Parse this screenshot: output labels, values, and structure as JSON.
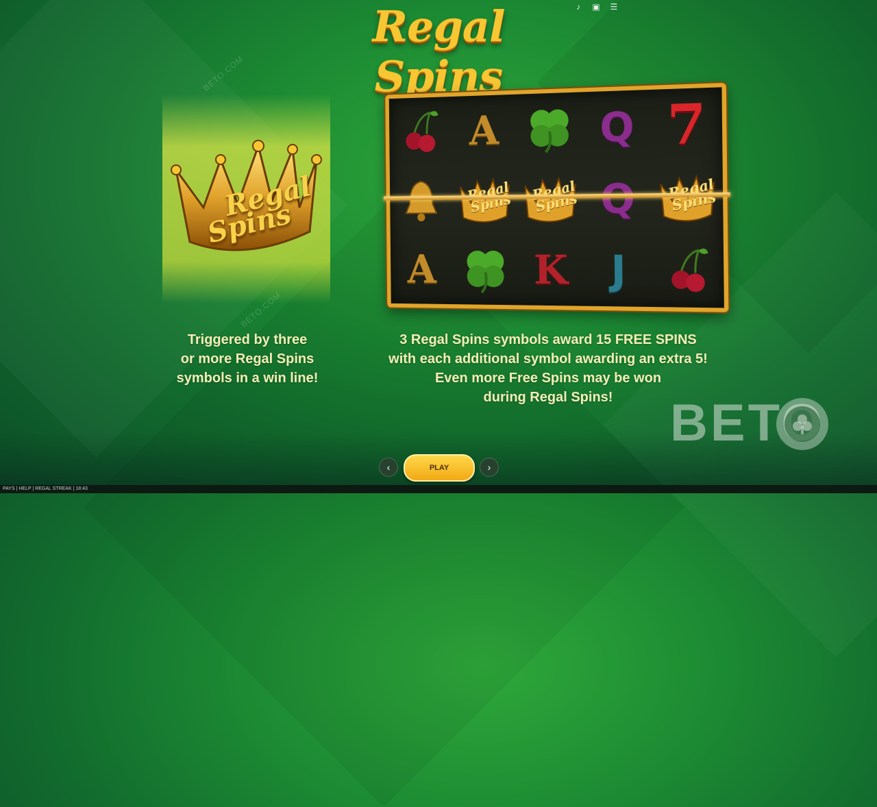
{
  "game": {
    "title": "Regal Spins",
    "crown_symbol_text": [
      "Regal",
      "Spins"
    ],
    "mini_crown_text": "Regal Spins"
  },
  "header_icons": [
    "sound-icon",
    "fullscreen-icon",
    "menu-icon"
  ],
  "reels": {
    "rows": [
      [
        "cherry",
        "A",
        "clover",
        "Q",
        "7"
      ],
      [
        "bell",
        "crown",
        "crown",
        "Q",
        "crown"
      ],
      [
        "A",
        "clover",
        "K",
        "J",
        "cherry"
      ]
    ]
  },
  "descriptions": {
    "left": [
      "Triggered by three",
      "or more Regal Spins",
      "symbols in a win line!"
    ],
    "right": [
      "3 Regal Spins symbols award 15 FREE SPINS",
      "with each additional symbol awarding an extra 5!",
      "Even more Free Spins may be won",
      "during Regal Spins!"
    ]
  },
  "watermark": {
    "brand": "BETO",
    "small": "BETO.COM"
  },
  "controls": {
    "prev": "‹",
    "play": "PLAY",
    "next": "›"
  },
  "status_bar": "PAYS | HELP | REGAL STREAK | 18:43",
  "colors": {
    "gold": "#f7c632",
    "text": "#f4eeb6",
    "play": "#ffd84a"
  }
}
